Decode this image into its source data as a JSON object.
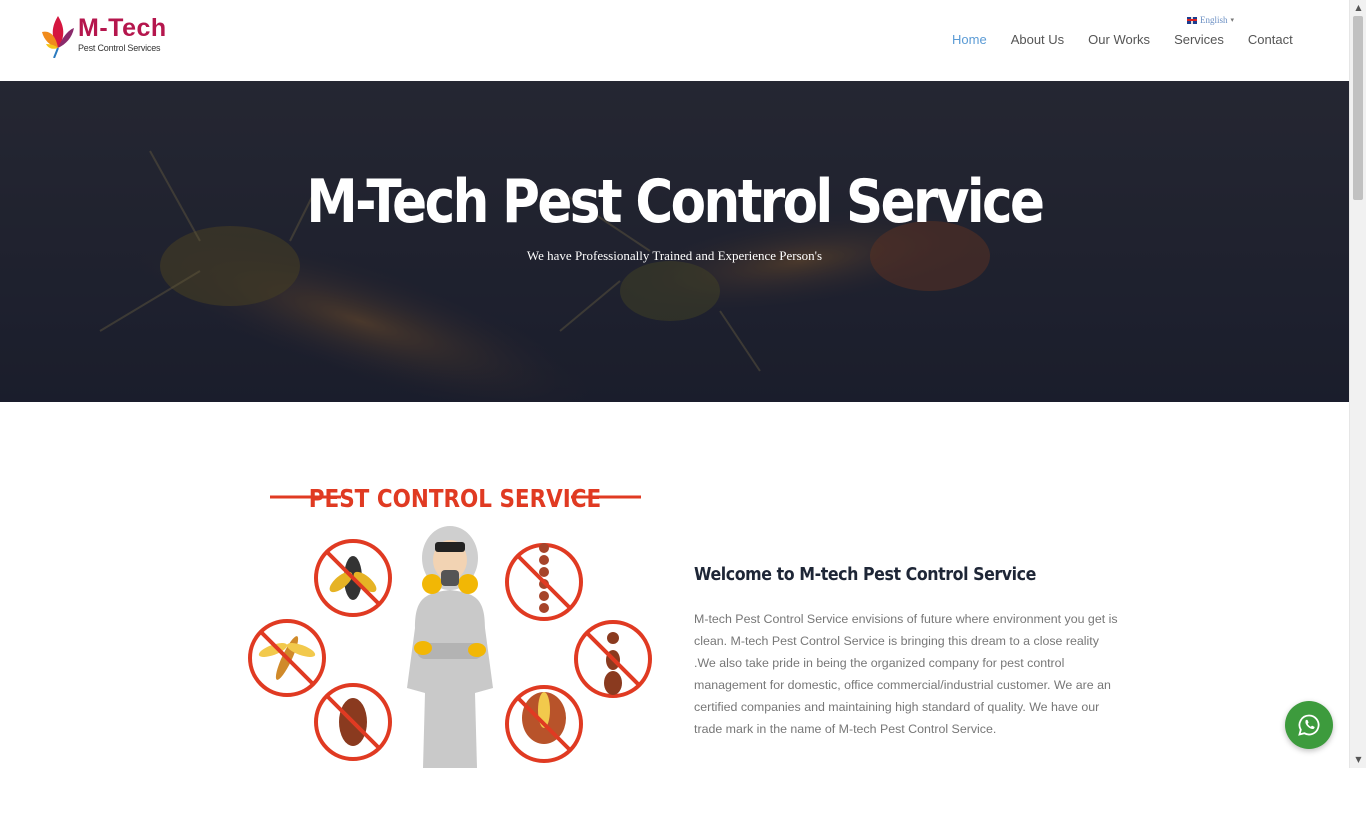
{
  "header": {
    "logo": {
      "name": "M-Tech",
      "tagline": "Pest Control Services"
    },
    "language": {
      "selected": "English"
    },
    "nav": [
      {
        "label": "Home",
        "active": true
      },
      {
        "label": "About Us",
        "active": false
      },
      {
        "label": "Our Works",
        "active": false
      },
      {
        "label": "Services",
        "active": false
      },
      {
        "label": "Contact",
        "active": false
      }
    ]
  },
  "hero": {
    "title": "M-Tech Pest Control Service",
    "subtitle": "We have Professionally Trained and Experience Person's"
  },
  "about": {
    "image_caption": "PEST CONTROL SERVICE",
    "heading": "Welcome to M-tech Pest Control Service",
    "body": "M-tech Pest Control Service envisions of future where environment you get is clean. M-tech Pest Control Service is bringing this dream to a close reality .We also take pride in being the organized company for pest control management for domestic, office commercial/industrial customer. We are an certified companies and maintaining high standard of quality. We have our trade mark in the name of M-tech Pest Control Service."
  },
  "colors": {
    "nav_active": "#5b9bd5",
    "brand": "#b5164d",
    "hero_overlay": "#1f2230",
    "whatsapp": "#3d9b3d",
    "illustration_red": "#e03a22"
  },
  "icons": {
    "whatsapp": "whatsapp-icon",
    "flag": "uk-flag-icon",
    "caret": "caret-down-icon"
  }
}
